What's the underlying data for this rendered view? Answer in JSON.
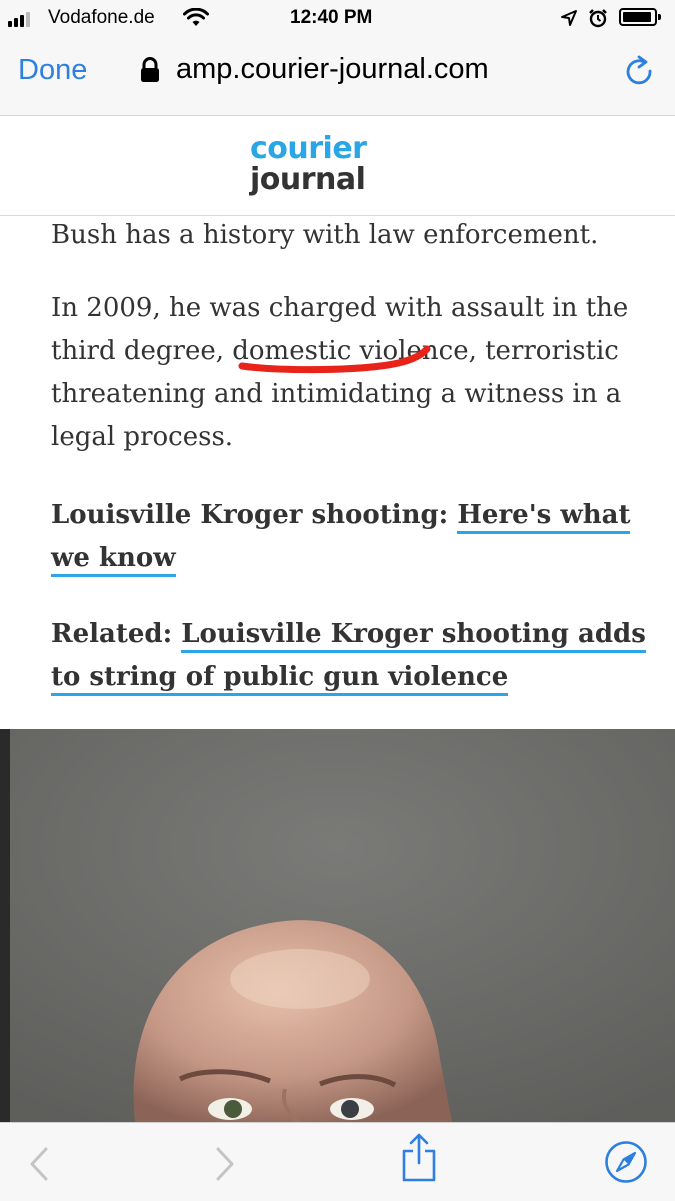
{
  "status_bar": {
    "carrier": "Vodafone.de",
    "time": "12:40 PM",
    "icons": [
      "signal-icon",
      "wifi-icon",
      "location-icon",
      "alarm-icon",
      "battery-icon"
    ]
  },
  "browser": {
    "done_label": "Done",
    "url": "amp.courier-journal.com",
    "icons": [
      "lock-icon",
      "reload-icon"
    ]
  },
  "site": {
    "logo_line1": "courier",
    "logo_line2": "journal"
  },
  "article": {
    "p1": "Bush has a history with law enforcement.",
    "p2_line1": "In 2009, he was charged with assault in the",
    "p2_line2": "third degree, domestic violence, terroristic",
    "p2_line3": "threatening and intimidating a witness in a",
    "p2_line4": "legal process.",
    "p3_prefix": "Louisville Kroger shooting:",
    "p3_link_line1": "Here's what",
    "p3_link_line2": "we know",
    "p4_prefix": "Related:",
    "p4_link_line1": "Louisville Kroger shooting adds",
    "p4_link_line2": "to string of public gun violence"
  },
  "toolbar": {
    "icons": [
      "back-icon",
      "forward-icon",
      "share-icon",
      "safari-compass-icon"
    ]
  },
  "colors": {
    "link_blue": "#2d7fe0",
    "brand_blue": "#2aa6e6",
    "annotation_red": "#e8231a"
  }
}
